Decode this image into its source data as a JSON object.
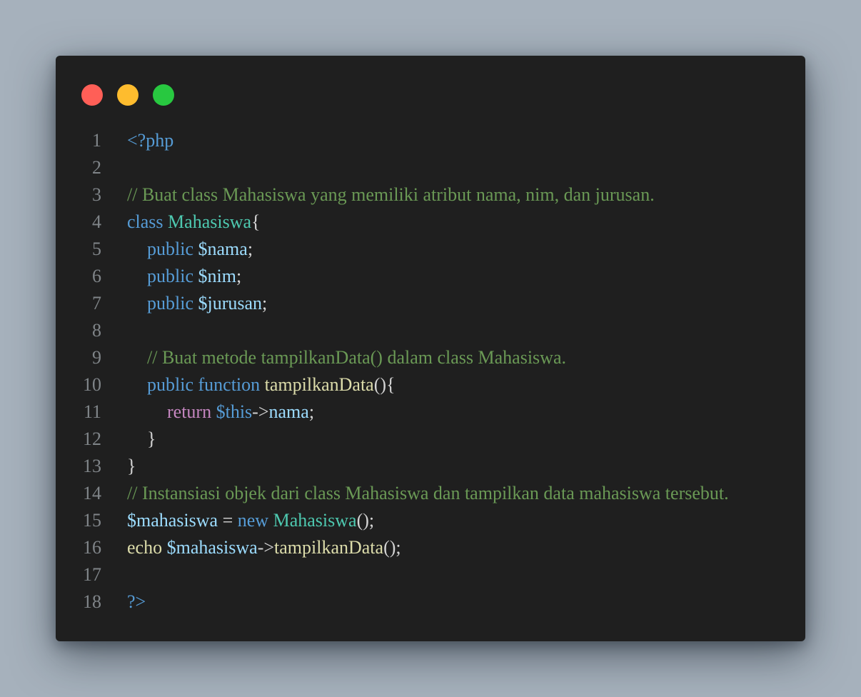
{
  "window": {
    "controls": [
      {
        "name": "close-button",
        "color": "#ff5f57"
      },
      {
        "name": "minimize-button",
        "color": "#febc2e"
      },
      {
        "name": "maximize-button",
        "color": "#28c840"
      }
    ]
  },
  "code": {
    "lines": [
      {
        "n": "1",
        "indent": 0,
        "tokens": [
          {
            "t": "<?php",
            "c": "kw"
          }
        ]
      },
      {
        "n": "2",
        "indent": 0,
        "tokens": []
      },
      {
        "n": "3",
        "indent": 0,
        "tokens": [
          {
            "t": "// Buat class Mahasiswa yang memiliki atribut nama, nim, dan jurusan.",
            "c": "cm"
          }
        ]
      },
      {
        "n": "4",
        "indent": 0,
        "tokens": [
          {
            "t": "class ",
            "c": "kw"
          },
          {
            "t": "Mahasiswa",
            "c": "cls"
          },
          {
            "t": "{",
            "c": "pn"
          }
        ]
      },
      {
        "n": "5",
        "indent": 1,
        "tokens": [
          {
            "t": "public ",
            "c": "kw"
          },
          {
            "t": "$nama",
            "c": "var"
          },
          {
            "t": ";",
            "c": "pn"
          }
        ]
      },
      {
        "n": "6",
        "indent": 1,
        "tokens": [
          {
            "t": "public ",
            "c": "kw"
          },
          {
            "t": "$nim",
            "c": "var"
          },
          {
            "t": ";",
            "c": "pn"
          }
        ]
      },
      {
        "n": "7",
        "indent": 1,
        "tokens": [
          {
            "t": "public ",
            "c": "kw"
          },
          {
            "t": "$jurusan",
            "c": "var"
          },
          {
            "t": ";",
            "c": "pn"
          }
        ]
      },
      {
        "n": "8",
        "indent": 0,
        "tokens": []
      },
      {
        "n": "9",
        "indent": 1,
        "tokens": [
          {
            "t": "// Buat metode tampilkanData() dalam class Mahasiswa.",
            "c": "cm"
          }
        ]
      },
      {
        "n": "10",
        "indent": 1,
        "tokens": [
          {
            "t": "public ",
            "c": "kw"
          },
          {
            "t": "function ",
            "c": "kw"
          },
          {
            "t": "tampilkanData",
            "c": "fn"
          },
          {
            "t": "(){",
            "c": "pn"
          }
        ]
      },
      {
        "n": "11",
        "indent": 2,
        "tokens": [
          {
            "t": "return ",
            "c": "ctl"
          },
          {
            "t": "$this",
            "c": "kw"
          },
          {
            "t": "->",
            "c": "pn"
          },
          {
            "t": "nama",
            "c": "var"
          },
          {
            "t": ";",
            "c": "pn"
          }
        ]
      },
      {
        "n": "12",
        "indent": 1,
        "tokens": [
          {
            "t": "}",
            "c": "pn"
          }
        ]
      },
      {
        "n": "13",
        "indent": 0,
        "tokens": [
          {
            "t": "}",
            "c": "pn"
          }
        ]
      },
      {
        "n": "14",
        "indent": 0,
        "tokens": [
          {
            "t": "// Instansiasi objek dari class Mahasiswa dan tampilkan data mahasiswa tersebut.",
            "c": "cm"
          }
        ]
      },
      {
        "n": "15",
        "indent": 0,
        "tokens": [
          {
            "t": "$mahasiswa",
            "c": "var"
          },
          {
            "t": " = ",
            "c": "pn"
          },
          {
            "t": "new ",
            "c": "kw"
          },
          {
            "t": "Mahasiswa",
            "c": "cls"
          },
          {
            "t": "();",
            "c": "pn"
          }
        ]
      },
      {
        "n": "16",
        "indent": 0,
        "tokens": [
          {
            "t": "echo ",
            "c": "fn"
          },
          {
            "t": "$mahasiswa",
            "c": "var"
          },
          {
            "t": "->",
            "c": "pn"
          },
          {
            "t": "tampilkanData",
            "c": "fn"
          },
          {
            "t": "();",
            "c": "pn"
          }
        ]
      },
      {
        "n": "17",
        "indent": 0,
        "tokens": []
      },
      {
        "n": "18",
        "indent": 0,
        "tokens": [
          {
            "t": "?>",
            "c": "kw"
          }
        ]
      }
    ]
  }
}
